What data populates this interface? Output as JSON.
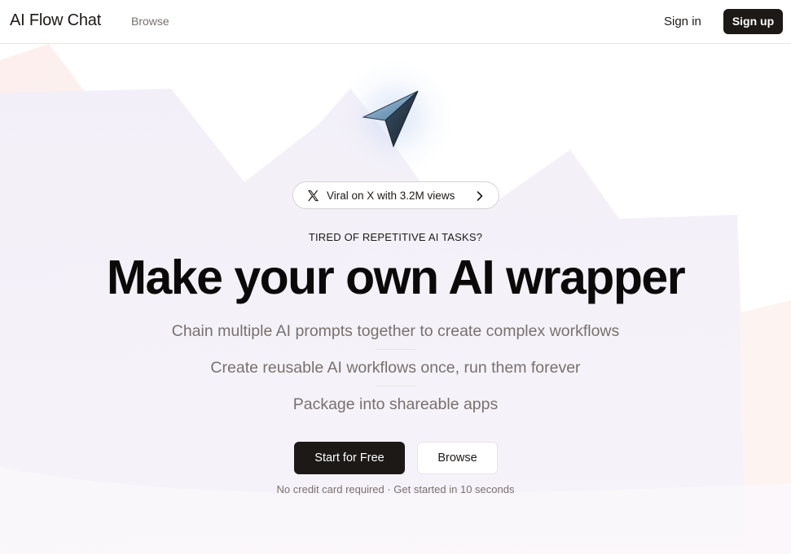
{
  "header": {
    "brand": "AI Flow Chat",
    "nav_browse": "Browse",
    "sign_in": "Sign in",
    "sign_up": "Sign up"
  },
  "hero": {
    "viral_badge": {
      "icon": "x-logo-icon",
      "text": "Viral on X with 3.2M views",
      "trailing_icon": "chevron-right-icon"
    },
    "eyebrow": "TIRED OF REPETITIVE AI TASKS?",
    "headline": "Make your own AI wrapper",
    "features": [
      "Chain multiple AI prompts together to create complex workflows",
      "Create reusable AI workflows once, run them forever",
      "Package into shareable apps"
    ],
    "primary_cta": "Start for Free",
    "secondary_cta": "Browse",
    "note": "No credit card required · Get started in 10 seconds"
  },
  "colors": {
    "primary": "#1c1917",
    "muted_text": "#78716c",
    "border": "#e7e5e4",
    "bg_lavender": "#f2f0fa",
    "bg_peach": "#fdf1ef"
  }
}
